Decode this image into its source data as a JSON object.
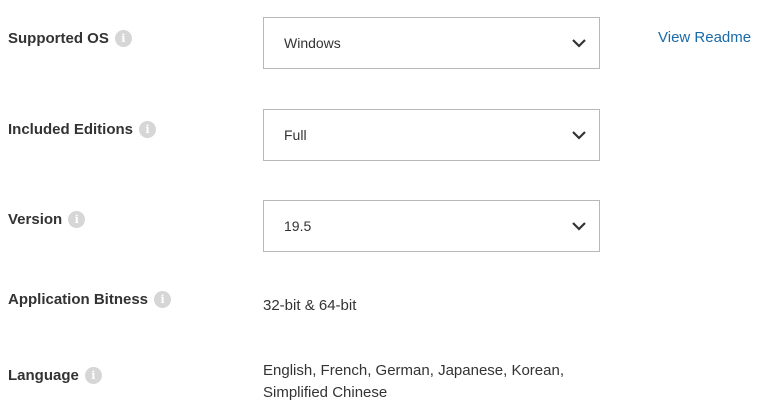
{
  "rows": {
    "os": {
      "label": "Supported OS",
      "value": "Windows"
    },
    "editions": {
      "label": "Included Editions",
      "value": "Full"
    },
    "version": {
      "label": "Version",
      "value": "19.5"
    },
    "bitness": {
      "label": "Application Bitness",
      "value": "32-bit & 64-bit"
    },
    "language": {
      "label": "Language",
      "value_line1": "English, French, German, Japanese, Korean,",
      "value_line2": "Simplified Chinese"
    }
  },
  "readme_link": "View Readme",
  "info_glyph": "i",
  "icons": {
    "info": "info-icon",
    "dropdown": "chevron-down-icon"
  },
  "colors": {
    "link": "#1a6aa8",
    "border": "#b8b8b8",
    "info_icon": "#d6d6d6",
    "text": "#333333"
  }
}
